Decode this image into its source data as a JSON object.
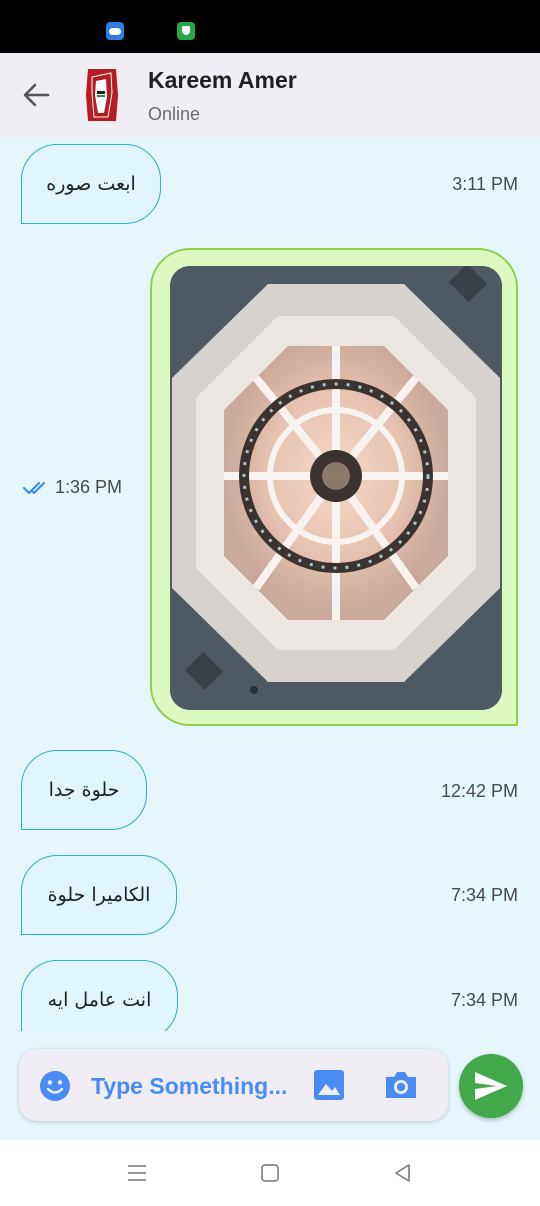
{
  "header": {
    "contact_name": "Kareem Amer",
    "contact_status": "Online"
  },
  "messages": [
    {
      "direction": "incoming",
      "type": "text",
      "text": "ابعت صوره",
      "time": "3:11 PM"
    },
    {
      "direction": "outgoing",
      "type": "image",
      "time": "1:36 PM",
      "status": "read"
    },
    {
      "direction": "incoming",
      "type": "text",
      "text": "حلوة جدا",
      "time": "12:42 PM"
    },
    {
      "direction": "incoming",
      "type": "text",
      "text": "الكاميرا حلوة",
      "time": "7:34 PM"
    },
    {
      "direction": "incoming",
      "type": "text",
      "text": "انت عامل ايه",
      "time": "7:34 PM"
    }
  ],
  "composer": {
    "placeholder": "Type Something..."
  },
  "icons": {
    "back": "arrow-back-icon",
    "emoji": "emoji-icon",
    "gallery": "image-icon",
    "camera": "camera-icon",
    "send": "send-icon",
    "read_receipt": "double-check-icon"
  },
  "colors": {
    "accent": "#4a8cf7",
    "send_button": "#41a94a",
    "incoming_bubble": "#e1f5fe",
    "incoming_border": "#2ab0cf",
    "outgoing_bubble": "#dcf9c2",
    "outgoing_border": "#8dd148"
  }
}
